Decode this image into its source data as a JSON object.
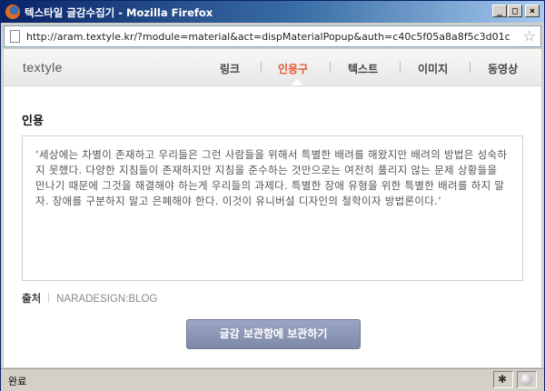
{
  "window": {
    "title": "텍스타일 글감수집기 - Mozilla Firefox",
    "controls": {
      "minimize": "_",
      "maximize": "□",
      "close": "×"
    }
  },
  "address": {
    "url": "http://aram.textyle.kr/?module=material&act=dispMaterialPopup&auth=c40c5f05a8a8f5c3d01c"
  },
  "nav": {
    "logo": "textyle",
    "items": [
      {
        "label": "링크",
        "active": false
      },
      {
        "label": "인용구",
        "active": true
      },
      {
        "label": "텍스트",
        "active": false
      },
      {
        "label": "이미지",
        "active": false
      },
      {
        "label": "동영상",
        "active": false
      }
    ]
  },
  "content": {
    "section_title": "인용",
    "quote": "‘세상에는 차별이 존재하고 우리들은 그런 사람들을 위해서 특별한 배려를 해왔지만 배려의 방법은 성숙하지 못했다. 다양한 지침들이 존재하지만 지침을 준수하는 것만으로는 여전히 풀리지 않는 문제 상황들을 만나기 때문에 그것을 해결해야 하는게 우리들의 과제다. 특별한 장애 유형을 위한 특별한 배려를 하지 말자. 장애를 구분하지 말고 은폐해야 한다. 이것이 유니버설 디자인의 철학이자 방법론이다.’",
    "source_label": "출처",
    "source_value": "NARADESIGN:BLOG",
    "save_button": "글감 보관함에 보관하기"
  },
  "status": {
    "text": "완료"
  },
  "icons": {
    "firefox": "firefox-icon",
    "page": "page-icon",
    "bookmark": "star-icon",
    "bug": "bug-icon",
    "status_circle": "status-circle-icon"
  },
  "colors": {
    "titlebar_start": "#0a246a",
    "active_nav": "#e25a2c",
    "button": "#8a94b2"
  }
}
